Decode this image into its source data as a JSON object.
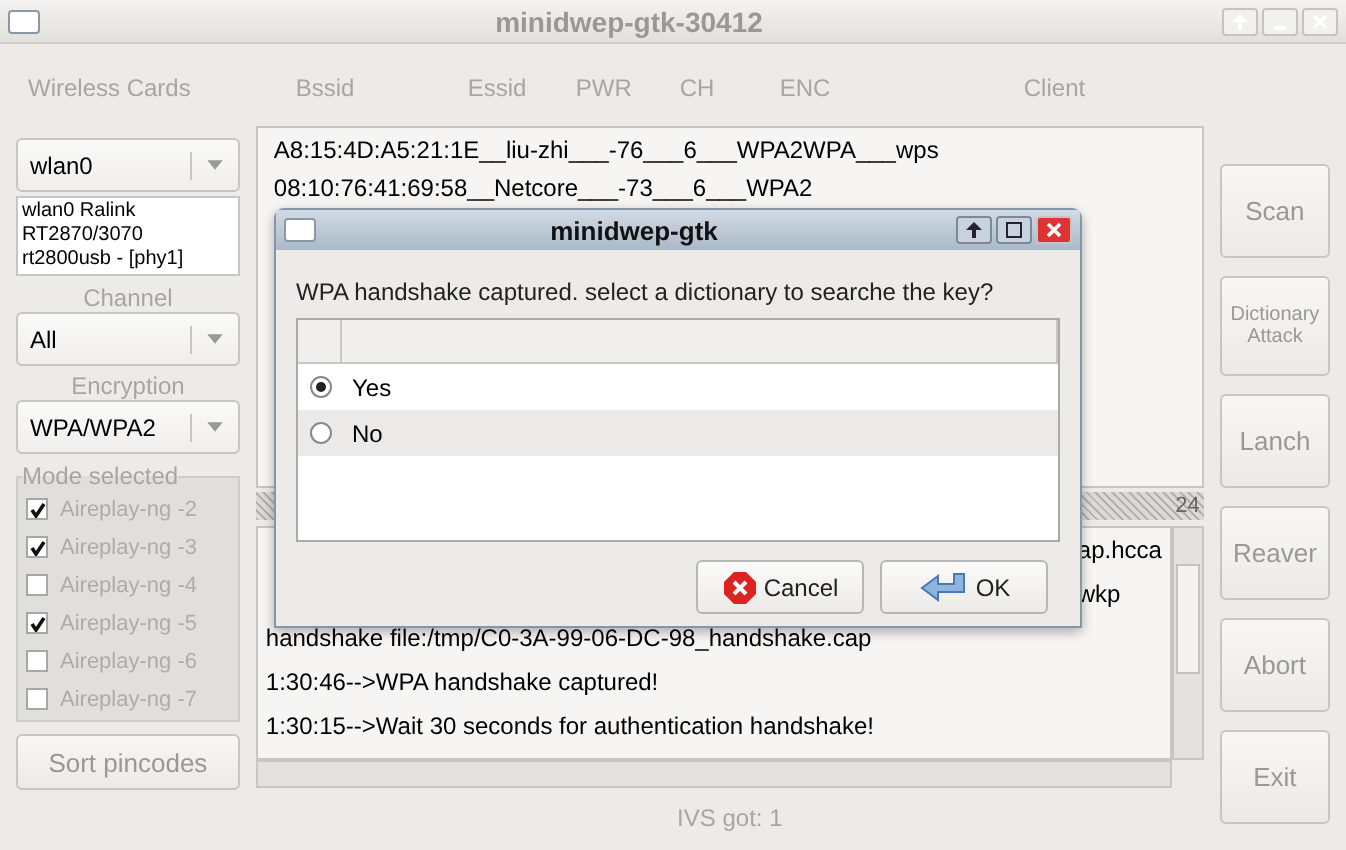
{
  "window": {
    "title": "minidwep-gtk-30412"
  },
  "left": {
    "cards_label": "Wireless Cards",
    "card": "wlan0",
    "card_info": "wlan0 Ralink RT2870/3070 rt2800usb - [phy1]",
    "channel_label": "Channel",
    "channel": "All",
    "encryption_label": "Encryption",
    "encryption": "WPA/WPA2",
    "mode_label": "Mode selected",
    "modes": [
      {
        "label": "Aireplay-ng -2",
        "checked": true
      },
      {
        "label": "Aireplay-ng -3",
        "checked": true
      },
      {
        "label": "Aireplay-ng -4",
        "checked": false
      },
      {
        "label": "Aireplay-ng -5",
        "checked": true
      },
      {
        "label": "Aireplay-ng -6",
        "checked": false
      },
      {
        "label": "Aireplay-ng -7",
        "checked": false
      }
    ],
    "sort_button": "Sort pincodes"
  },
  "columns": [
    "Bssid",
    "Essid",
    "PWR",
    "CH",
    "ENC",
    "Client"
  ],
  "networks": [
    "A8:15:4D:A5:21:1E__liu-zhi___-76___6___WPA2WPA___wps",
    "08:10:76:41:69:58__Netcore___-73___6___WPA2"
  ],
  "separator_count": "24",
  "log": [
    {
      "kind": "partial",
      "text": "ap.hcca"
    },
    {
      "kind": "partial",
      "text": "wkp"
    },
    {
      "kind": "full",
      "text": "handshake file:/tmp/C0-3A-99-06-DC-98_handshake.cap"
    },
    {
      "kind": "full",
      "text": "1:30:46-->WPA handshake captured!"
    },
    {
      "kind": "full",
      "text": "1:30:15-->Wait 30 seconds for authentication handshake!"
    }
  ],
  "status": "IVS got: 1",
  "buttons": [
    {
      "label": "Scan",
      "kind": "large"
    },
    {
      "label": "Dictionary Attack",
      "kind": "small"
    },
    {
      "label": "Lanch",
      "kind": "large"
    },
    {
      "label": "Reaver",
      "kind": "large"
    },
    {
      "label": "Abort",
      "kind": "large"
    },
    {
      "label": "Exit",
      "kind": "large"
    }
  ],
  "dialog": {
    "title": "minidwep-gtk",
    "message": "WPA handshake captured. select a dictionary to searche the key?",
    "options": [
      {
        "label": "Yes",
        "selected": true
      },
      {
        "label": "No",
        "selected": false
      }
    ],
    "cancel": "Cancel",
    "ok": "OK"
  }
}
